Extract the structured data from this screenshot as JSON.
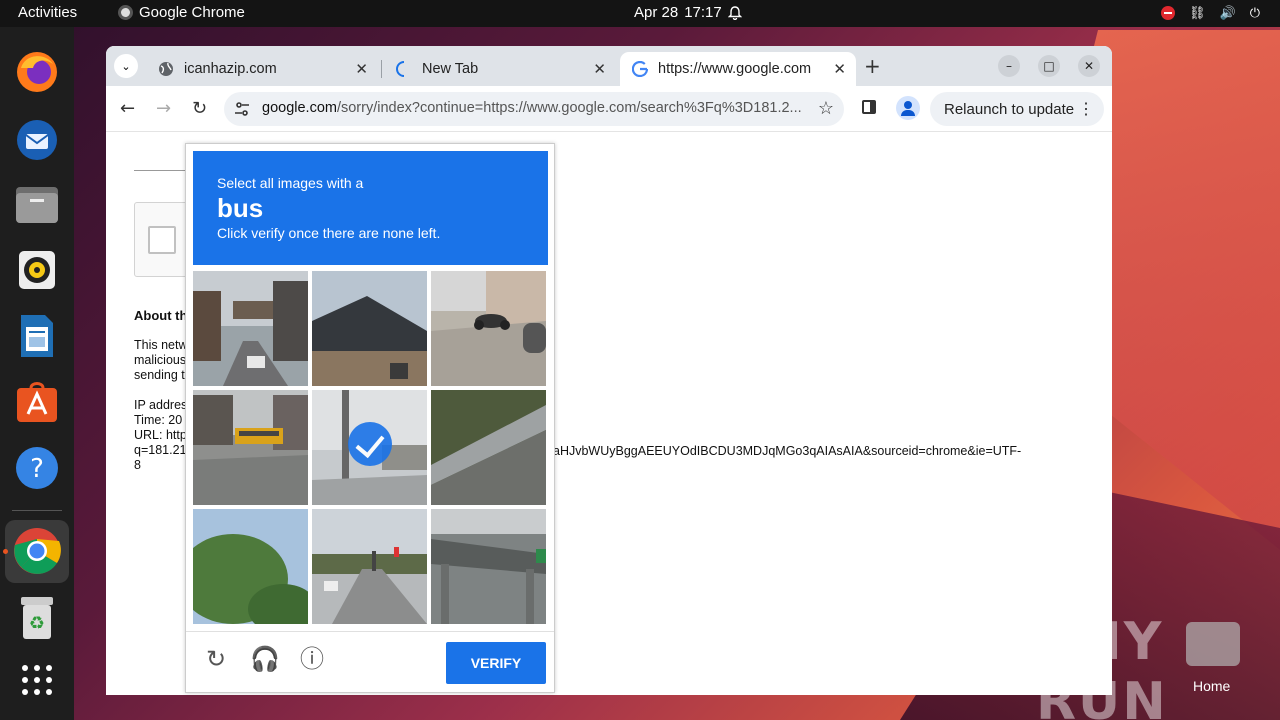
{
  "topbar": {
    "activities": "Activities",
    "app_name": "Google Chrome",
    "date": "Apr 28",
    "time": "17:17"
  },
  "browser": {
    "tabs": [
      {
        "title": "icanhazip.com",
        "close": "✕"
      },
      {
        "title": "New Tab",
        "close": "✕"
      },
      {
        "title": "https://www.google.com",
        "close": "✕"
      }
    ],
    "new_tab": "+",
    "url_domain": "google.com",
    "url_path": "/sorry/index?continue=https://www.google.com/search%3Fq%3D181.2...",
    "relaunch_label": "Relaunch to update",
    "window_controls": [
      "–",
      "□",
      "✕"
    ]
  },
  "page": {
    "about_heading": "About th",
    "para1": [
      "This netw",
      "malicious",
      "sending t"
    ],
    "para2": [
      "IP addres",
      "Time: 20",
      "URL: http",
      "q=181.21",
      "8"
    ],
    "url_tail": "aHJvbWUyBggAEEUYOdIBCDU3MDJqMGo3qAIAsAIA&sourceid=chrome&ie=UTF-"
  },
  "captcha": {
    "instruction_line1": "Select all images with a",
    "target": "bus",
    "instruction_line3": "Click verify once there are none left.",
    "verify_label": "VERIFY",
    "selected_tile": 4,
    "tiles": [
      "street-with-car",
      "house-roof",
      "sidewalk-motorcycle",
      "street-with-bus",
      "street-pole-selected",
      "highway-barrier",
      "trees-and-sky",
      "road-with-traffic-lights",
      "overpass-bridge"
    ]
  },
  "desktop": {
    "watermark": "ANY RUN",
    "home_label": "Home"
  },
  "colors": {
    "accent_blue": "#1a73e8",
    "ubuntu_orange": "#e95420",
    "dock_bg": "#1e1e1e"
  }
}
